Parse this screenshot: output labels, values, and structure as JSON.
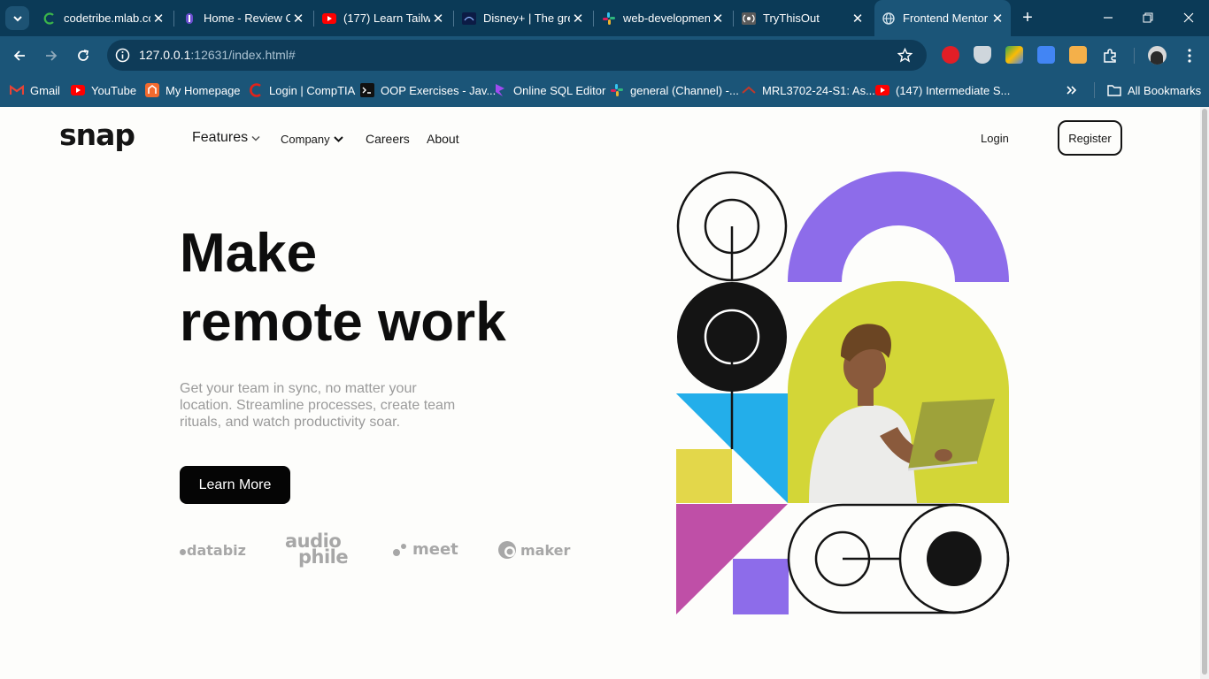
{
  "browser": {
    "tabs": [
      {
        "title": "codetribe.mlab.co",
        "icon": "codetribe-icon"
      },
      {
        "title": "Home - Review Co",
        "icon": "review-icon"
      },
      {
        "title": "(177) Learn Tailwi",
        "icon": "youtube-icon"
      },
      {
        "title": "Disney+ | The gre",
        "icon": "disney-icon"
      },
      {
        "title": "web-developmen",
        "icon": "slack-icon"
      },
      {
        "title": "TryThisOut",
        "icon": "broadcast-icon"
      },
      {
        "title": "Frontend Mentor",
        "icon": "globe-icon"
      }
    ],
    "url_host": "127.0.0.1",
    "url_rest": ":12631/index.html#",
    "bookmarks": [
      {
        "label": "Gmail",
        "icon": "gmail-icon"
      },
      {
        "label": "YouTube",
        "icon": "youtube-icon"
      },
      {
        "label": "My Homepage",
        "icon": "homepage-icon"
      },
      {
        "label": "Login | CompTIA",
        "icon": "comptia-icon"
      },
      {
        "label": "OOP Exercises - Jav...",
        "icon": "terminal-icon"
      },
      {
        "label": "Online SQL Editor",
        "icon": "sql-icon"
      },
      {
        "label": "general (Channel) -...",
        "icon": "slack-icon"
      },
      {
        "label": "MRL3702-24-S1: As...",
        "icon": "unisa-icon"
      },
      {
        "label": "(147) Intermediate S...",
        "icon": "youtube-icon"
      }
    ],
    "all_bookmarks": "All Bookmarks"
  },
  "site": {
    "logo": "snap",
    "nav": {
      "features": "Features",
      "company": "Company",
      "careers": "Careers",
      "about": "About"
    },
    "login": "Login",
    "register": "Register"
  },
  "hero": {
    "title_line1": "Make",
    "title_line2": "remote work",
    "description": "Get your team in sync, no matter your location. Streamline processes, create team rituals, and watch productivity soar.",
    "cta": "Learn More"
  },
  "clients": {
    "databiz": "databiz",
    "audiophile_1": "audio",
    "audiophile_2": "phile",
    "meet": "meet",
    "maker": "maker"
  },
  "colors": {
    "purple": "#8d6cea",
    "lime": "#d3d637",
    "sky": "#23aeea",
    "mustard": "#e3d74a",
    "magenta": "#bf4fa7",
    "dark": "#141414"
  }
}
